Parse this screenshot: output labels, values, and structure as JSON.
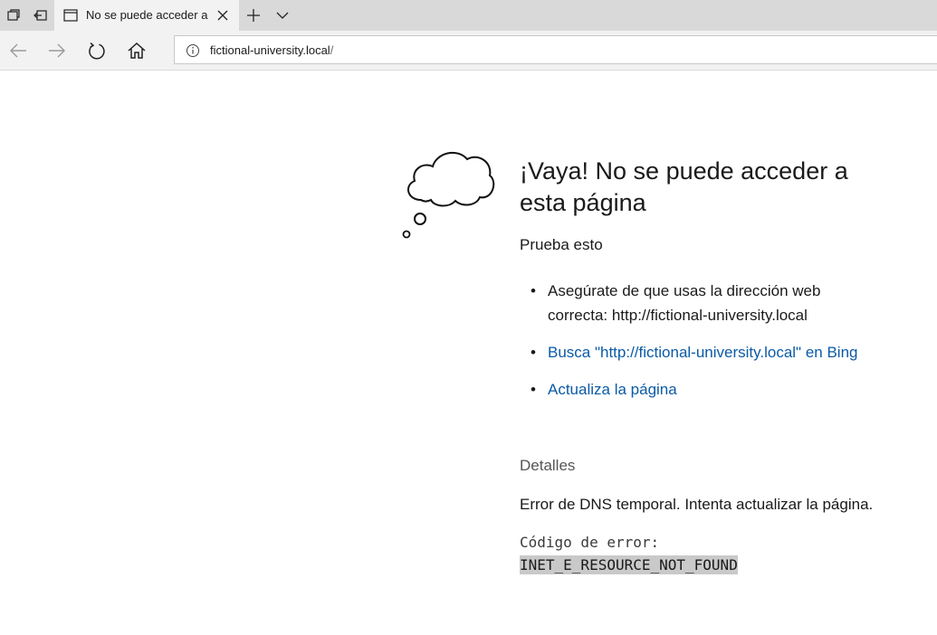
{
  "tab": {
    "title": "No se puede acceder a"
  },
  "address_bar": {
    "url_host": "fictional-university.local",
    "url_path": "/"
  },
  "error_page": {
    "headline": "¡Vaya! No se puede acceder a esta página",
    "try_heading": "Prueba esto",
    "suggestions": [
      {
        "text": "Asegúrate de que usas la dirección web correcta: http://fictional-university.local",
        "is_link": false
      },
      {
        "text": "Busca \"http://fictional-university.local\" en Bing",
        "is_link": true
      },
      {
        "text": "Actualiza la página",
        "is_link": true
      }
    ],
    "details_label": "Detalles",
    "details_text": "Error de DNS temporal. Intenta actualizar la página.",
    "error_code_label": "Código de error:",
    "error_code": "INET_E_RESOURCE_NOT_FOUND"
  },
  "icons": {
    "tab_actions": "tab-overview-icon",
    "set_aside": "set-aside-tabs-icon",
    "page": "page-icon",
    "close": "close-icon",
    "new_tab": "plus-icon",
    "tab_menu": "chevron-down-icon",
    "back": "back-arrow-icon",
    "forward": "forward-arrow-icon",
    "refresh": "refresh-icon",
    "home": "home-icon",
    "info": "info-icon",
    "cloud": "thought-cloud-icon"
  },
  "colors": {
    "link": "#0b5aa6",
    "tabbar_bg": "#d9d9d9",
    "active_tab_bg": "#f2f2f2",
    "error_code_highlight": "#c9c9c9"
  }
}
